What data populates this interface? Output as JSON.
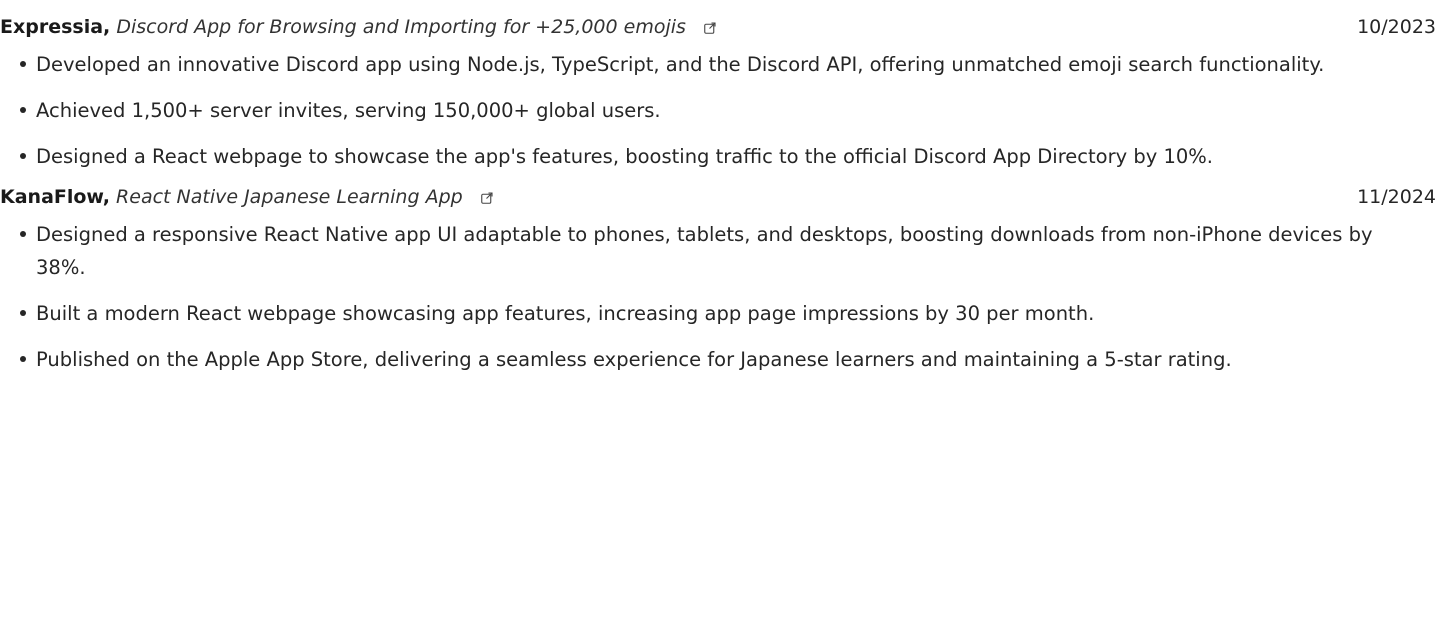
{
  "projects": [
    {
      "name": "Expressia,",
      "description": "Discord App for Browsing and Importing for +25,000 emojis",
      "link_icon": "external-link-icon",
      "date": "10/2023",
      "bullets": [
        "Developed an innovative Discord app using Node.js, TypeScript, and the Discord API, offering unmatched emoji search functionality.",
        "Achieved 1,500+ server invites, serving 150,000+ global users.",
        "Designed a React webpage to showcase the app's features, boosting traffic to the official Discord App Directory by 10%."
      ]
    },
    {
      "name": "KanaFlow,",
      "description": "React Native Japanese Learning App",
      "link_icon": "external-link-icon",
      "date": "11/2024",
      "bullets": [
        "Designed a responsive React Native app UI adaptable to phones, tablets, and desktops, boosting downloads from non-iPhone devices by 38%.",
        "Built a modern React webpage showcasing app features, increasing app page impressions by 30 per month.",
        "Published on the Apple App Store, delivering a seamless experience for Japanese learners and maintaining a 5-star rating."
      ]
    }
  ]
}
